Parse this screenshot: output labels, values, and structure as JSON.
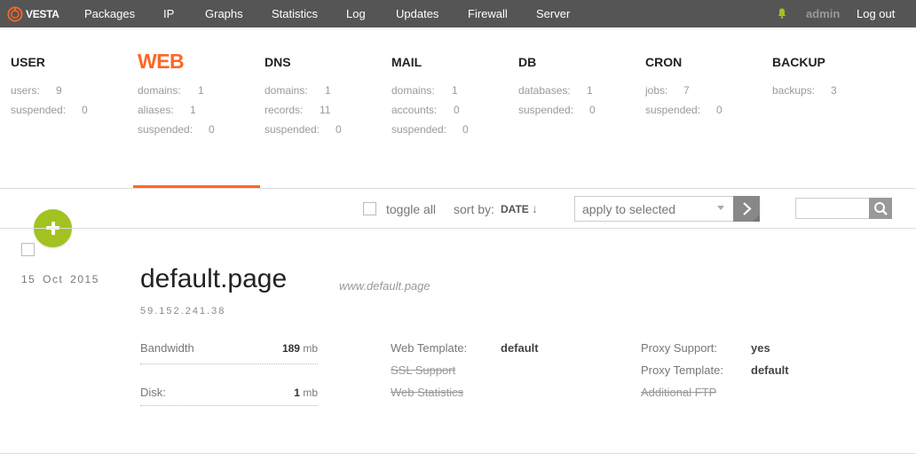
{
  "app": {
    "logo_text": "VESTA"
  },
  "nav": {
    "items": [
      {
        "label": "Packages"
      },
      {
        "label": "IP"
      },
      {
        "label": "Graphs"
      },
      {
        "label": "Statistics"
      },
      {
        "label": "Log"
      },
      {
        "label": "Updates"
      },
      {
        "label": "Firewall"
      },
      {
        "label": "Server"
      }
    ],
    "user": "admin",
    "logout": "Log out"
  },
  "panels": [
    {
      "title": "USER",
      "stats": [
        {
          "label": "users:",
          "value": "9"
        },
        {
          "label": "suspended:",
          "value": "0"
        }
      ]
    },
    {
      "title": "WEB",
      "stats": [
        {
          "label": "domains:",
          "value": "1"
        },
        {
          "label": "aliases:",
          "value": "1"
        },
        {
          "label": "suspended:",
          "value": "0"
        }
      ]
    },
    {
      "title": "DNS",
      "stats": [
        {
          "label": "domains:",
          "value": "1"
        },
        {
          "label": "records:",
          "value": "11"
        },
        {
          "label": "suspended:",
          "value": "0"
        }
      ]
    },
    {
      "title": "MAIL",
      "stats": [
        {
          "label": "domains:",
          "value": "1"
        },
        {
          "label": "accounts:",
          "value": "0"
        },
        {
          "label": "suspended:",
          "value": "0"
        }
      ]
    },
    {
      "title": "DB",
      "stats": [
        {
          "label": "databases:",
          "value": "1"
        },
        {
          "label": "suspended:",
          "value": "0"
        }
      ]
    },
    {
      "title": "CRON",
      "stats": [
        {
          "label": "jobs:",
          "value": "7"
        },
        {
          "label": "suspended:",
          "value": "0"
        }
      ]
    },
    {
      "title": "BACKUP",
      "stats": [
        {
          "label": "backups:",
          "value": "3"
        }
      ]
    }
  ],
  "active_panel": "WEB",
  "toolbar": {
    "toggle_all": "toggle all",
    "sort_by": "sort by:",
    "sort_value": "DATE",
    "sort_arrow": "↓",
    "apply_selected": "apply to selected",
    "search_value": ""
  },
  "domain": {
    "date": "15 Oct 2015",
    "name": "default.page",
    "alias": "www.default.page",
    "ip": "59.152.241.38",
    "bandwidth": {
      "label": "Bandwidth",
      "value": "189",
      "unit": "mb"
    },
    "disk": {
      "label": "Disk:",
      "value": "1",
      "unit": "mb"
    },
    "web_template": {
      "label": "Web Template:",
      "value": "default"
    },
    "ssl_support": {
      "label": "SSL Support"
    },
    "web_statistics": {
      "label": "Web Statistics"
    },
    "proxy_support": {
      "label": "Proxy Support:",
      "value": "yes"
    },
    "proxy_template": {
      "label": "Proxy Template:",
      "value": "default"
    },
    "additional_ftp": {
      "label": "Additional FTP"
    }
  },
  "colors": {
    "topbar": "#555555",
    "accent": "#ff6624",
    "add_button": "#a2c221",
    "notification": "#a2c221"
  }
}
